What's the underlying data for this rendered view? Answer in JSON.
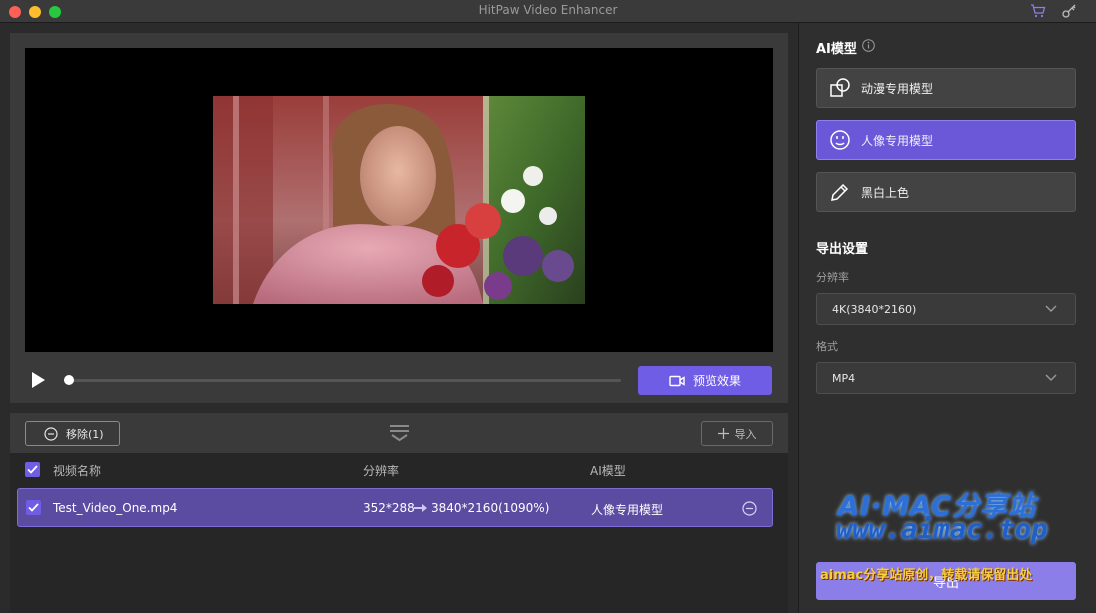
{
  "window": {
    "title": "HitPaw Video Enhancer"
  },
  "preview": {
    "button_label": "预览效果"
  },
  "list": {
    "remove_label": "移除(1)",
    "import_label": "导入",
    "headers": {
      "name": "视频名称",
      "resolution": "分辨率",
      "model": "AI模型"
    },
    "rows": [
      {
        "name": "Test_Video_One.mp4",
        "from": "352*288",
        "to": "3840*2160(1090%)",
        "model": "人像专用模型"
      }
    ]
  },
  "sidebar": {
    "ai_title": "AI模型",
    "models": [
      {
        "label": "动漫专用模型",
        "icon": "anime-model-icon"
      },
      {
        "label": "人像专用模型",
        "icon": "portrait-model-icon",
        "selected": true
      },
      {
        "label": "黑白上色",
        "icon": "colorize-icon"
      }
    ],
    "export_title": "导出设置",
    "resolution_label": "分辨率",
    "resolution_value": "4K(3840*2160)",
    "format_label": "格式",
    "format_value": "MP4",
    "export_label": "导出"
  },
  "watermark": {
    "title": "AI·MAC分享站",
    "url": "www.aimac.top",
    "band": "aimac分享站原创，转载请保留出处"
  },
  "colors": {
    "accent": "#6f5ee5",
    "selected_row": "#5b4ca2",
    "export": "#8b7ee8"
  }
}
